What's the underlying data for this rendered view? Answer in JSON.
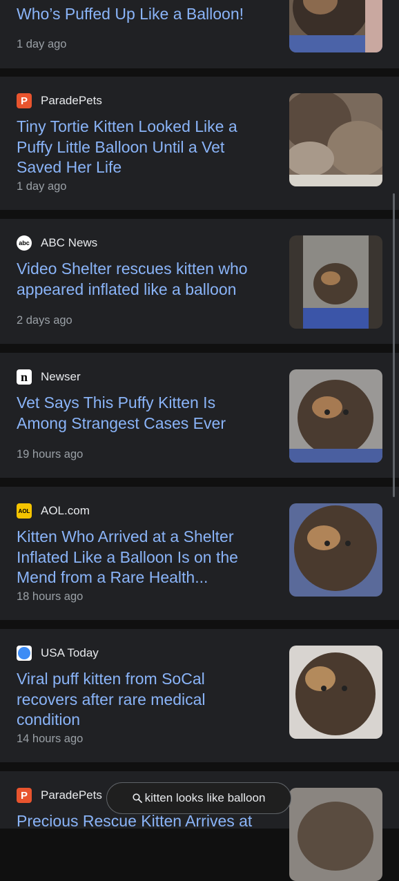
{
  "results": [
    {
      "source": "",
      "headline": "Who’s Puffed Up Like a Balloon!",
      "time": "1 day ago"
    },
    {
      "source": "ParadePets",
      "headline": "Tiny Tortie Kitten Looked Like a Puffy Little Balloon Until a Vet Saved Her Life",
      "time": "1 day ago"
    },
    {
      "source": "ABC News",
      "headline": "Video Shelter rescues kitten who appeared inflated like a balloon",
      "time": "2 days ago"
    },
    {
      "source": "Newser",
      "headline": "Vet Says This Puffy Kitten Is Among Strangest Cases Ever",
      "time": "19 hours ago"
    },
    {
      "source": "AOL.com",
      "headline": "Kitten Who Arrived at a Shelter Inflated Like a Balloon Is on the Mend from a Rare Health...",
      "time": "18 hours ago"
    },
    {
      "source": "USA Today",
      "headline": "Viral puff kitten from SoCal recovers after rare medical condition",
      "time": "14 hours ago"
    },
    {
      "source": "ParadePets",
      "headline": "Precious Rescue Kitten Arrives at",
      "time": ""
    }
  ],
  "logos": {
    "paradepets": {
      "glyph": "P",
      "color": "#e8542e"
    },
    "abc": {
      "glyph": "abc",
      "color": "#ffffff"
    },
    "newser": {
      "glyph": "n",
      "color": "#ffffff"
    },
    "aol": {
      "glyph": "AOL",
      "color": "#f5c400"
    },
    "usatoday": {
      "glyph": "",
      "color": "#3d8cf5"
    }
  },
  "search": {
    "icon": "search-icon",
    "query": "kitten looks like balloon"
  },
  "colors": {
    "background": "#101010",
    "card": "#202124",
    "headline": "#8ab4f8",
    "meta": "#9aa0a6"
  }
}
